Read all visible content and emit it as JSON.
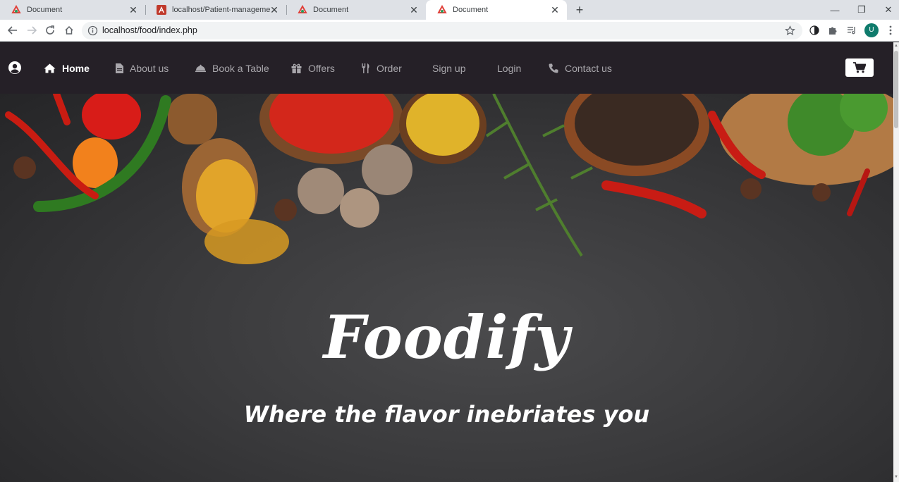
{
  "browser": {
    "tabs": [
      {
        "title": "Document",
        "favicon": "app-icon",
        "active": false
      },
      {
        "title": "localhost/Patient-management-a",
        "favicon": "angular-icon",
        "active": false
      },
      {
        "title": "Document",
        "favicon": "app-icon",
        "active": false
      },
      {
        "title": "Document",
        "favicon": "app-icon",
        "active": true
      }
    ],
    "url": "localhost/food/index.php",
    "profile_initial": "U"
  },
  "site": {
    "nav": [
      {
        "label": "Home",
        "icon": "home-icon",
        "active": true
      },
      {
        "label": "About us",
        "icon": "file-icon",
        "active": false
      },
      {
        "label": "Book a Table",
        "icon": "cloche-icon",
        "active": false
      },
      {
        "label": "Offers",
        "icon": "gift-icon",
        "active": false
      },
      {
        "label": "Order",
        "icon": "utensils-icon",
        "active": false
      },
      {
        "label": "Sign up",
        "icon": "",
        "active": false
      },
      {
        "label": "Login",
        "icon": "",
        "active": false
      },
      {
        "label": "Contact us",
        "icon": "phone-icon",
        "active": false
      }
    ],
    "hero": {
      "brand": "Foodify",
      "tagline": "Where the flavor inebriates you"
    }
  },
  "colors": {
    "nav_bg": "#252027",
    "nav_text": "#a8a6ab",
    "nav_active": "#ffffff",
    "hero_text": "#ffffff"
  }
}
